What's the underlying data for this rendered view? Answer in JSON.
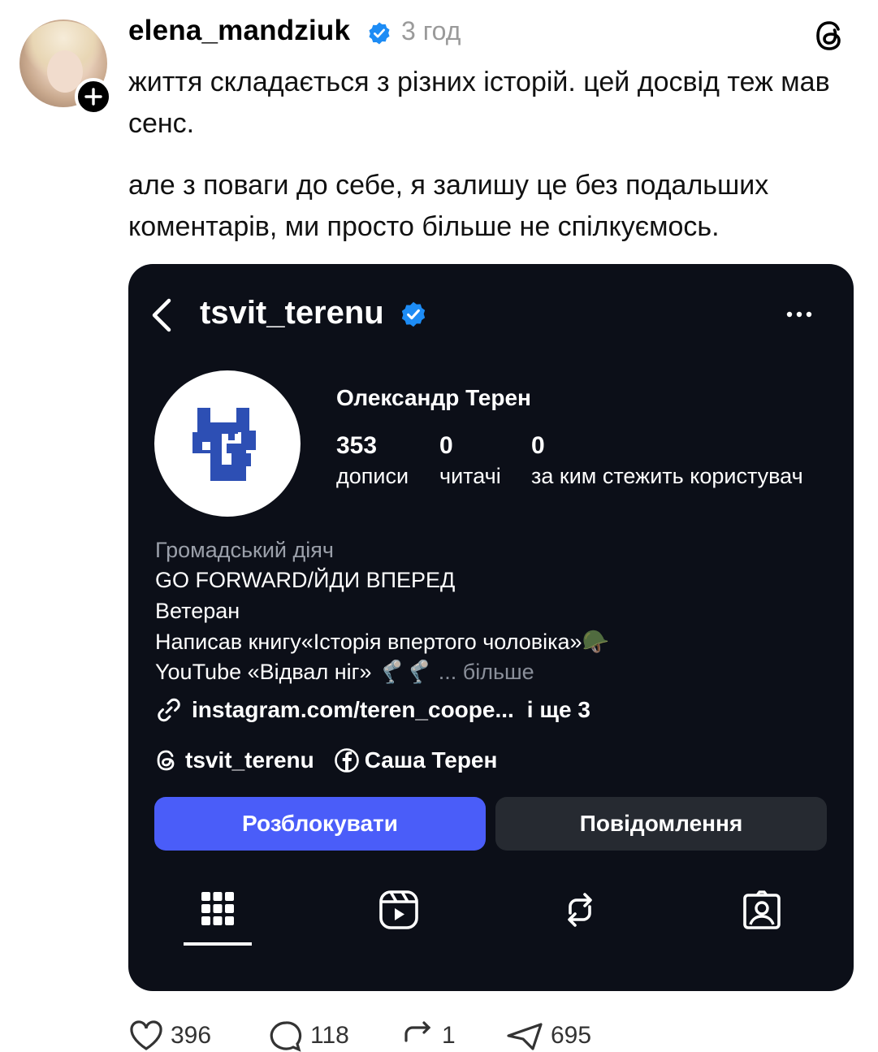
{
  "post": {
    "username": "elena_mandziuk",
    "time_ago": "3 год",
    "text_paragraph_1": "життя складається з різних історій. цей досвід теж мав сенс.",
    "text_paragraph_2": "але з поваги до себе, я залишу це без подальших коментарів, ми просто більше не спілкуємось."
  },
  "embedded_profile": {
    "handle": "tsvit_terenu",
    "full_name": "Олександр Терен",
    "stats": [
      {
        "value": "353",
        "label": "дописи"
      },
      {
        "value": "0",
        "label": "читачі"
      },
      {
        "value": "0",
        "label": "за ким стежить користувач"
      }
    ],
    "category": "Громадський діяч",
    "bio_lines": [
      "GO FORWARD/ЙДИ ВПЕРЕД",
      "Ветеран",
      "Написав книгу«Історія впертого чоловіка»🪖",
      "YouTube «Відвал ніг» 🦿🦿"
    ],
    "more_label": "... більше",
    "link_text": "instagram.com/teren_coope...",
    "link_more": "і ще 3",
    "threads_handle": "tsvit_terenu",
    "facebook_name": "Саша Терен",
    "unblock_button": "Розблокувати",
    "message_button": "Повідомлення",
    "tabs": [
      "grid-icon",
      "reels-icon",
      "reposts-icon",
      "tagged-icon"
    ],
    "accent_color": "#4a5df9"
  },
  "actions": {
    "likes": "396",
    "comments": "118",
    "reposts": "1",
    "shares": "695"
  }
}
